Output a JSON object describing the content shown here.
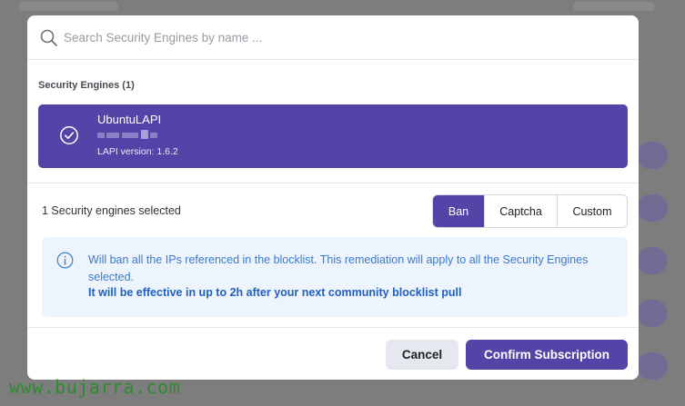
{
  "search": {
    "placeholder": "Search Security Engines by name ...",
    "value": ""
  },
  "engines": {
    "section_title": "Security Engines (1)",
    "items": [
      {
        "name": "UbuntuLAPI",
        "ip_redacted": true,
        "version": "LAPI version: 1.6.2",
        "selected": true
      }
    ]
  },
  "remediation": {
    "selected_count": "1 Security engines selected",
    "options": [
      "Ban",
      "Captcha",
      "Custom"
    ],
    "selected": "Ban"
  },
  "info": {
    "message": "Will ban all the IPs referenced in the blocklist. This remediation will apply to all the Security Engines selected.",
    "emphasis": "It will be effective in up to 2h after your next community blocklist pull"
  },
  "footer": {
    "cancel_label": "Cancel",
    "confirm_label": "Confirm Subscription"
  },
  "watermark": "www.bujarra.com",
  "colors": {
    "accent": "#5444a8",
    "info_background": "#eef4fc",
    "info_text": "#3d78c9",
    "overlay": "#7d7d7d"
  }
}
